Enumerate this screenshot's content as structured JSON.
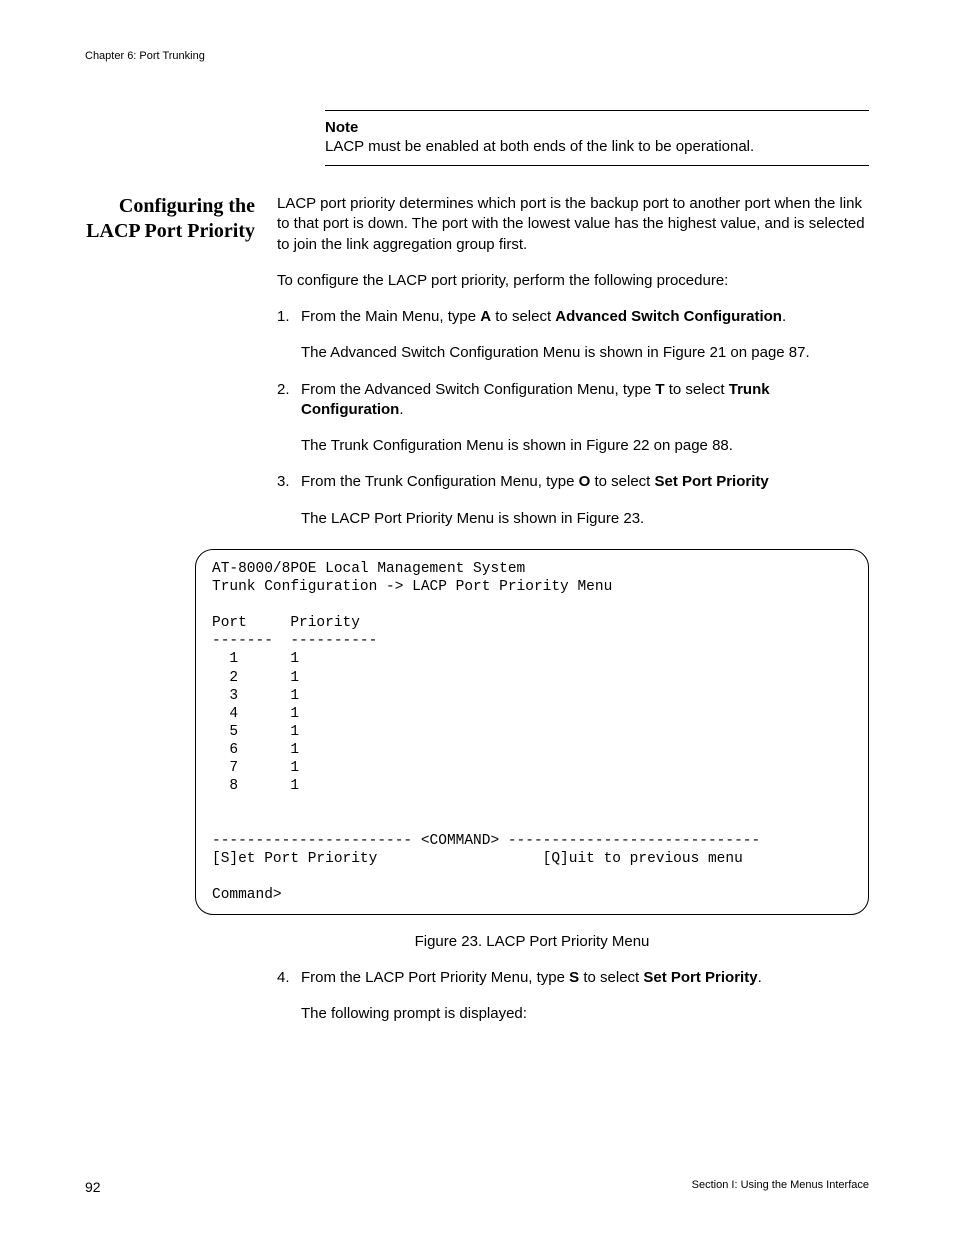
{
  "header": {
    "chapter": "Chapter 6: Port Trunking"
  },
  "note": {
    "title": "Note",
    "body": "LACP must be enabled at both ends of the link to be operational."
  },
  "section": {
    "heading": "Configuring the LACP Port Priority",
    "intro1": "LACP port priority determines which port is the backup port to another port when the link to that port is down. The port with the lowest value has the highest value, and is selected to join the link aggregation group first.",
    "intro2": "To configure the LACP port priority, perform the following procedure:",
    "steps": [
      {
        "num": "1.",
        "text_pre": "From the Main Menu, type ",
        "key": "A",
        "text_mid": " to select ",
        "target": "Advanced Switch Configuration",
        "text_post": ".",
        "sub": "The Advanced Switch Configuration Menu is shown in Figure 21 on page 87."
      },
      {
        "num": "2.",
        "text_pre": "From the Advanced Switch Configuration Menu, type ",
        "key": "T",
        "text_mid": " to select ",
        "target": "Trunk Configuration",
        "text_post": ".",
        "sub": "The Trunk Configuration Menu is shown in Figure 22 on page 88."
      },
      {
        "num": "3.",
        "text_pre": "From the Trunk Configuration Menu, type ",
        "key": "O",
        "text_mid": " to select ",
        "target": "Set Port Priority",
        "text_post": "",
        "sub": "The LACP Port Priority Menu is shown in Figure 23."
      }
    ],
    "step4": {
      "num": "4.",
      "text_pre": "From the LACP Port Priority Menu, type ",
      "key": "S",
      "text_mid": " to select ",
      "target": "Set Port Priority",
      "text_post": ".",
      "sub": "The following prompt is displayed:"
    }
  },
  "terminal": {
    "line1": "AT-8000/8POE Local Management System",
    "line2": "Trunk Configuration -> LACP Port Priority Menu",
    "col_port": "Port",
    "col_priority": "Priority",
    "sep_port": "-------",
    "sep_priority": "----------",
    "rows": [
      {
        "port": "1",
        "priority": "1"
      },
      {
        "port": "2",
        "priority": "1"
      },
      {
        "port": "3",
        "priority": "1"
      },
      {
        "port": "4",
        "priority": "1"
      },
      {
        "port": "5",
        "priority": "1"
      },
      {
        "port": "6",
        "priority": "1"
      },
      {
        "port": "7",
        "priority": "1"
      },
      {
        "port": "8",
        "priority": "1"
      }
    ],
    "command_divider": "----------------------- <COMMAND> -----------------------------",
    "option_set": "[S]et Port Priority",
    "option_quit": "[Q]uit to previous menu",
    "prompt": "Command>"
  },
  "figure_caption": "Figure 23. LACP Port Priority Menu",
  "footer": {
    "page": "92",
    "section": "Section I: Using the Menus Interface"
  }
}
